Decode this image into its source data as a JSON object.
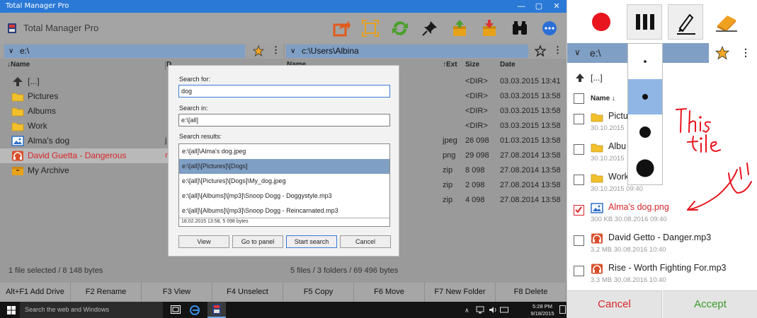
{
  "window": {
    "title": "Total Manager Pro",
    "minimize": "—",
    "maximize": "▢",
    "close": "✕"
  },
  "app": {
    "title": "Total Manager Pro"
  },
  "left_panel": {
    "path": "e:\\",
    "col_name": "↓Name",
    "col_date_trunc": "D",
    "rows": [
      {
        "name": "[...]",
        "ext": "",
        "icon": "up-icon"
      },
      {
        "name": "Pictures",
        "ext": "",
        "icon": "folder-icon"
      },
      {
        "name": "Albums",
        "ext": "",
        "icon": "folder-icon"
      },
      {
        "name": "Work",
        "ext": "",
        "icon": "folder-icon"
      },
      {
        "name": "Alma's dog",
        "ext": "j",
        "icon": "image-icon"
      },
      {
        "name": "David Guetta - Dangerous",
        "ext": "m",
        "icon": "audio-icon"
      },
      {
        "name": "My Archive",
        "ext": "",
        "icon": "archive-icon"
      }
    ],
    "status": "1 file selected / 8 148 bytes"
  },
  "right_panel": {
    "path": "c:\\Users\\Albina",
    "col_name": "Name",
    "col_ext": "↑Ext",
    "col_size": "Size",
    "col_date": "Date",
    "rows": [
      {
        "ext": "",
        "size": "<DIR>",
        "date": "03.03.2015 13:41"
      },
      {
        "ext": "",
        "size": "<DIR>",
        "date": "03.03.2015 13:58"
      },
      {
        "ext": "",
        "size": "<DIR>",
        "date": "03.03.2015 13:58"
      },
      {
        "ext": "",
        "size": "<DIR>",
        "date": "03.03.2015 13:58"
      },
      {
        "ext": "jpeg",
        "size": "26 098",
        "date": "01.03.2015 13:58"
      },
      {
        "ext": "png",
        "size": "29 098",
        "date": "27.08.2014 13:58"
      },
      {
        "ext": "zip",
        "size": "8 098",
        "date": "27.08.2014 13:58"
      },
      {
        "ext": "zip",
        "size": "2 098",
        "date": "27.08.2014 13:58"
      },
      {
        "ext": "zip",
        "size": "4 098",
        "date": "27.08.2014 13:58"
      }
    ],
    "status": "5 files / 3 folders / 69 496 bytes"
  },
  "search_dialog": {
    "search_for_label": "Search for:",
    "search_for_value": "dog",
    "search_in_label": "Search in:",
    "search_in_value": "e:\\[all]",
    "results_label": "Search results:",
    "results": [
      "e:\\[all]\\Alma's dog.jpeg",
      "e:\\[all]\\[Pictures]\\[Dogs]",
      "e:\\[all]\\[Pictures]\\[Dogs]\\My_dog.jpeg",
      "e:\\[all]\\[Albums]\\[mp3]\\Snoop Dogg - Doggystyle.mp3",
      "e:\\[all]\\[Albums]\\[mp3]\\Snoop Dogg - Reincarnated.mp3"
    ],
    "selected_index": 1,
    "result_info": "18.02.2015  13:58,   5 098 bytes",
    "btn_view": "View",
    "btn_go": "Go to panel",
    "btn_start": "Start search",
    "btn_cancel": "Cancel"
  },
  "fkeys": [
    "Alt+F1 Add Drive",
    "F2 Rename",
    "F3 View",
    "F4 Unselect",
    "F5 Copy",
    "F6 Move",
    "F7 New Folder",
    "F8 Delete"
  ],
  "taskbar": {
    "search_placeholder": "Search the web and Windows",
    "time": "5:28 PM",
    "date": "9/18/2015"
  },
  "side": {
    "path": "e:\\",
    "up": "[...]",
    "name_header": "Name ↓",
    "items": [
      {
        "name": "Pictu",
        "meta": "30.10.2015",
        "icon": "folder-icon",
        "checked": false,
        "red": false
      },
      {
        "name": "Albu",
        "meta": "30.10.2015",
        "icon": "folder-icon",
        "checked": false,
        "red": false
      },
      {
        "name": "Work",
        "meta": "30.10.2015 09:40",
        "icon": "folder-icon",
        "checked": false,
        "red": false
      },
      {
        "name": "Alma's dog.png",
        "meta": "300 KB 30.08.2016 09:40",
        "icon": "image-icon",
        "checked": true,
        "red": true
      },
      {
        "name": "David Getto - Danger.mp3",
        "meta": "3.2 MB 30.08.2016 10:40",
        "icon": "audio-icon",
        "checked": false,
        "red": false
      },
      {
        "name": "Rise - Worth Fighting For.mp3",
        "meta": "3.3 MB 30.08.2016 10:40",
        "icon": "audio-icon",
        "checked": false,
        "red": false
      }
    ],
    "cancel": "Cancel",
    "accept": "Accept"
  },
  "colors": {
    "accent_blue": "#2b79d6",
    "selection": "#7f9fc4",
    "record_red": "#e8141e",
    "cancel_red": "#d7262b",
    "accept_green": "#3a9a2a",
    "star": "#f5a623"
  }
}
